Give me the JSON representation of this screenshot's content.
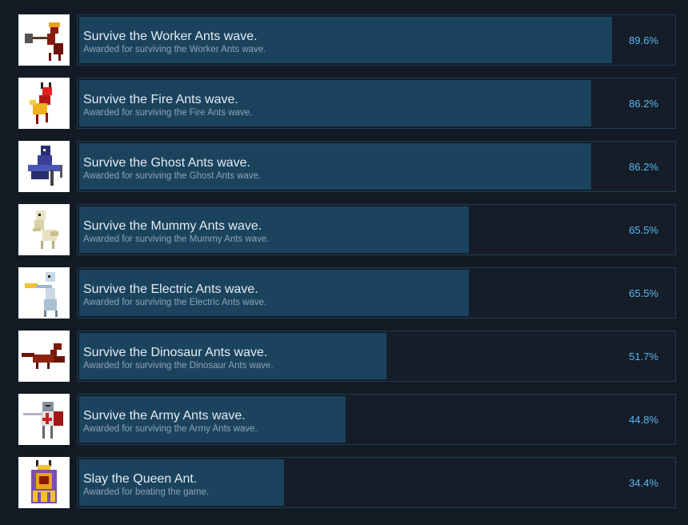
{
  "colors": {
    "background": "#131a24",
    "bar_border": "#1e3e55",
    "bar_fill": "#1b435e",
    "percent_text": "#5cb8f2"
  },
  "achievements": [
    {
      "title": "Survive the Worker Ants wave.",
      "description": "Awarded for surviving the Worker Ants wave.",
      "percent_label": "89.6%",
      "percent": 89.6,
      "icon": "worker-ant-icon"
    },
    {
      "title": "Survive the Fire Ants wave.",
      "description": "Awarded for surviving the Fire Ants wave.",
      "percent_label": "86.2%",
      "percent": 86.2,
      "icon": "fire-ant-icon"
    },
    {
      "title": "Survive the Ghost Ants wave.",
      "description": "Awarded for surviving the Ghost Ants wave.",
      "percent_label": "86.2%",
      "percent": 86.2,
      "icon": "ghost-ant-icon"
    },
    {
      "title": "Survive the Mummy Ants wave.",
      "description": "Awarded for surviving the Mummy Ants wave.",
      "percent_label": "65.5%",
      "percent": 65.5,
      "icon": "mummy-ant-icon"
    },
    {
      "title": "Survive the Electric Ants wave.",
      "description": "Awarded for surviving the Electric Ants wave.",
      "percent_label": "65.5%",
      "percent": 65.5,
      "icon": "electric-ant-icon"
    },
    {
      "title": "Survive the Dinosaur Ants wave.",
      "description": "Awarded for surviving the Dinosaur Ants wave.",
      "percent_label": "51.7%",
      "percent": 51.7,
      "icon": "dinosaur-ant-icon"
    },
    {
      "title": "Survive the Army Ants wave.",
      "description": "Awarded for surviving the Army Ants wave.",
      "percent_label": "44.8%",
      "percent": 44.8,
      "icon": "army-ant-icon"
    },
    {
      "title": "Slay the Queen Ant.",
      "description": "Awarded for beating the game.",
      "percent_label": "34.4%",
      "percent": 34.4,
      "icon": "queen-ant-icon"
    }
  ]
}
